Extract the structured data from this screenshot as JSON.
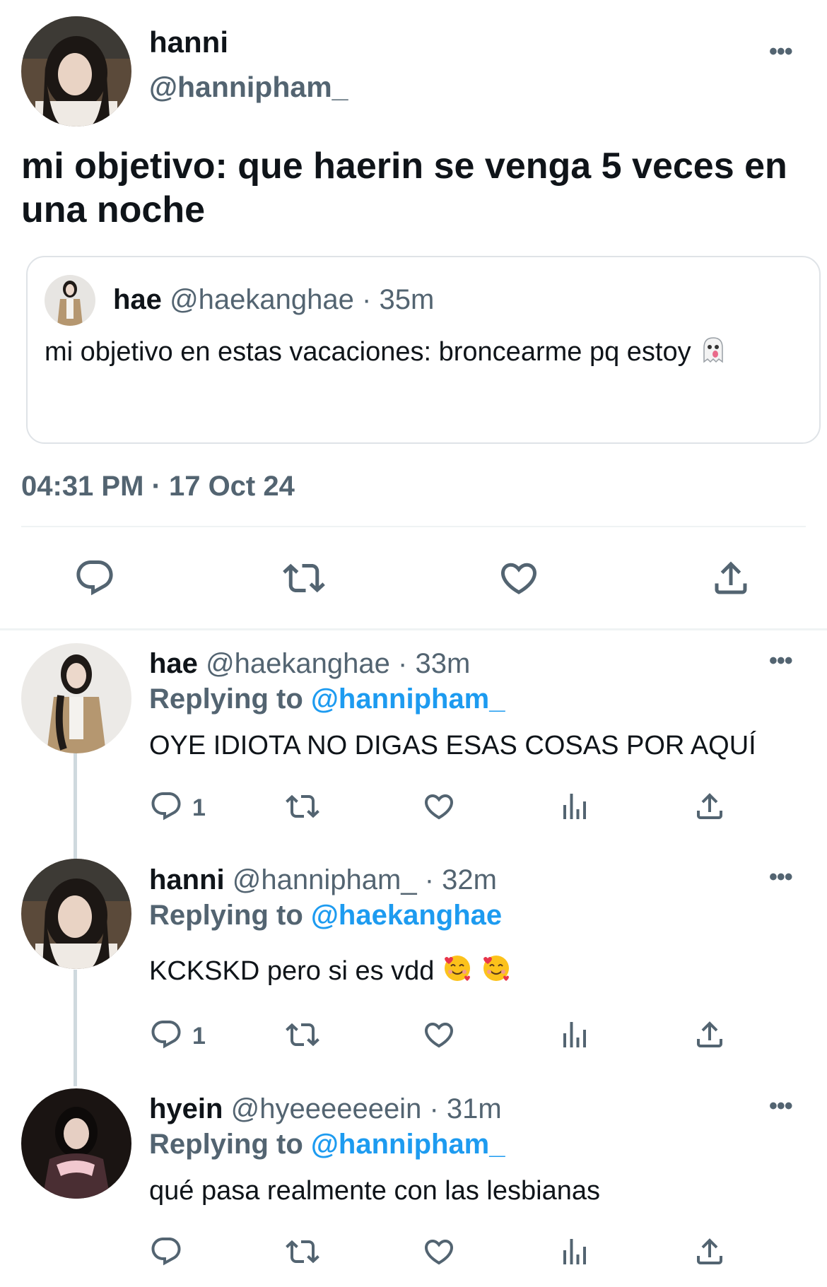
{
  "main_tweet": {
    "name": "hanni",
    "handle": "@hannipham_",
    "text": "mi objetivo: que haerin se venga 5 veces en una noche",
    "timestamp": "04:31 PM · 17 Oct 24",
    "quote": {
      "name": "hae",
      "handle": "@haekanghae",
      "sep": "·",
      "time": "35m",
      "text": "mi objetivo en estas vacaciones: broncearme pq estoy",
      "emoji": "ghost-emoji"
    }
  },
  "replies": [
    {
      "name": "hae",
      "handle": "@haekanghae",
      "sep": "·",
      "time": "33m",
      "replying_label": "Replying to",
      "replying_to": "@hannipham_",
      "text": "OYE IDIOTA NO DIGAS ESAS COSAS POR AQUÍ",
      "reply_count": "1"
    },
    {
      "name": "hanni",
      "handle": "@hannipham_",
      "sep": "·",
      "time": "32m",
      "replying_label": "Replying to",
      "replying_to": "@haekanghae",
      "text": "KCKSKD pero si es vdd",
      "emojis": [
        "smiling-face-with-hearts-emoji",
        "smiling-face-with-hearts-emoji"
      ],
      "reply_count": "1"
    },
    {
      "name": "hyein",
      "handle": "@hyeeeeeeein",
      "sep": "·",
      "time": "31m",
      "replying_label": "Replying to",
      "replying_to": "@hannipham_",
      "text": "qué pasa realmente con las lesbianas",
      "reply_count": ""
    }
  ],
  "icons": {
    "reply": "reply-icon",
    "retweet": "retweet-icon",
    "like": "heart-icon",
    "analytics": "analytics-icon",
    "share": "share-icon",
    "more": "more-icon"
  },
  "colors": {
    "text": "#0f1419",
    "secondary": "#536471",
    "link": "#1d9bf0",
    "divider": "#eff3f4"
  }
}
